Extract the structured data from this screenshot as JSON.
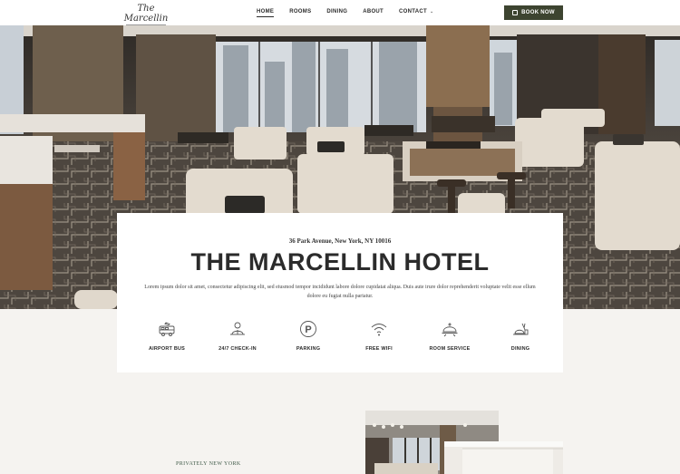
{
  "header": {
    "logo_script": "The Marcellin",
    "logo_sub": "NEW YORK",
    "nav": [
      {
        "label": "HOME",
        "active": true
      },
      {
        "label": "ROOMS"
      },
      {
        "label": "DINING"
      },
      {
        "label": "ABOUT"
      },
      {
        "label": "CONTACT",
        "has_dropdown": true
      }
    ],
    "book_label": "BOOK NOW",
    "book_icon": "calendar-icon"
  },
  "hero": {
    "address": "36 Park Avenue, New York, NY 10016",
    "title": "THE MARCELLIN HOTEL",
    "description": "Lorem ipsum dolor sit amet, consectetur adipiscing elit, sed eiusmod tempor incididunt labore dolore cupidatat aliqua. Duis aute irure dolor reprehenderit voluptate velit esse ellum dolore eu fugiat nulla pariatur."
  },
  "amenities": [
    {
      "label": "AIRPORT BUS",
      "icon": "bus-icon"
    },
    {
      "label": "24/7 CHECK-IN",
      "icon": "receptionist-icon"
    },
    {
      "label": "PARKING",
      "icon": "parking-icon"
    },
    {
      "label": "FREE WIFI",
      "icon": "wifi-icon"
    },
    {
      "label": "ROOM SERVICE",
      "icon": "cloche-icon"
    },
    {
      "label": "DINING",
      "icon": "dining-icon"
    }
  ],
  "section": {
    "eyebrow": "PRIVATELY NEW YORK"
  },
  "colors": {
    "accent": "#3d4430",
    "eyebrow": "#3f5a48",
    "background": "#f5f3f0"
  }
}
